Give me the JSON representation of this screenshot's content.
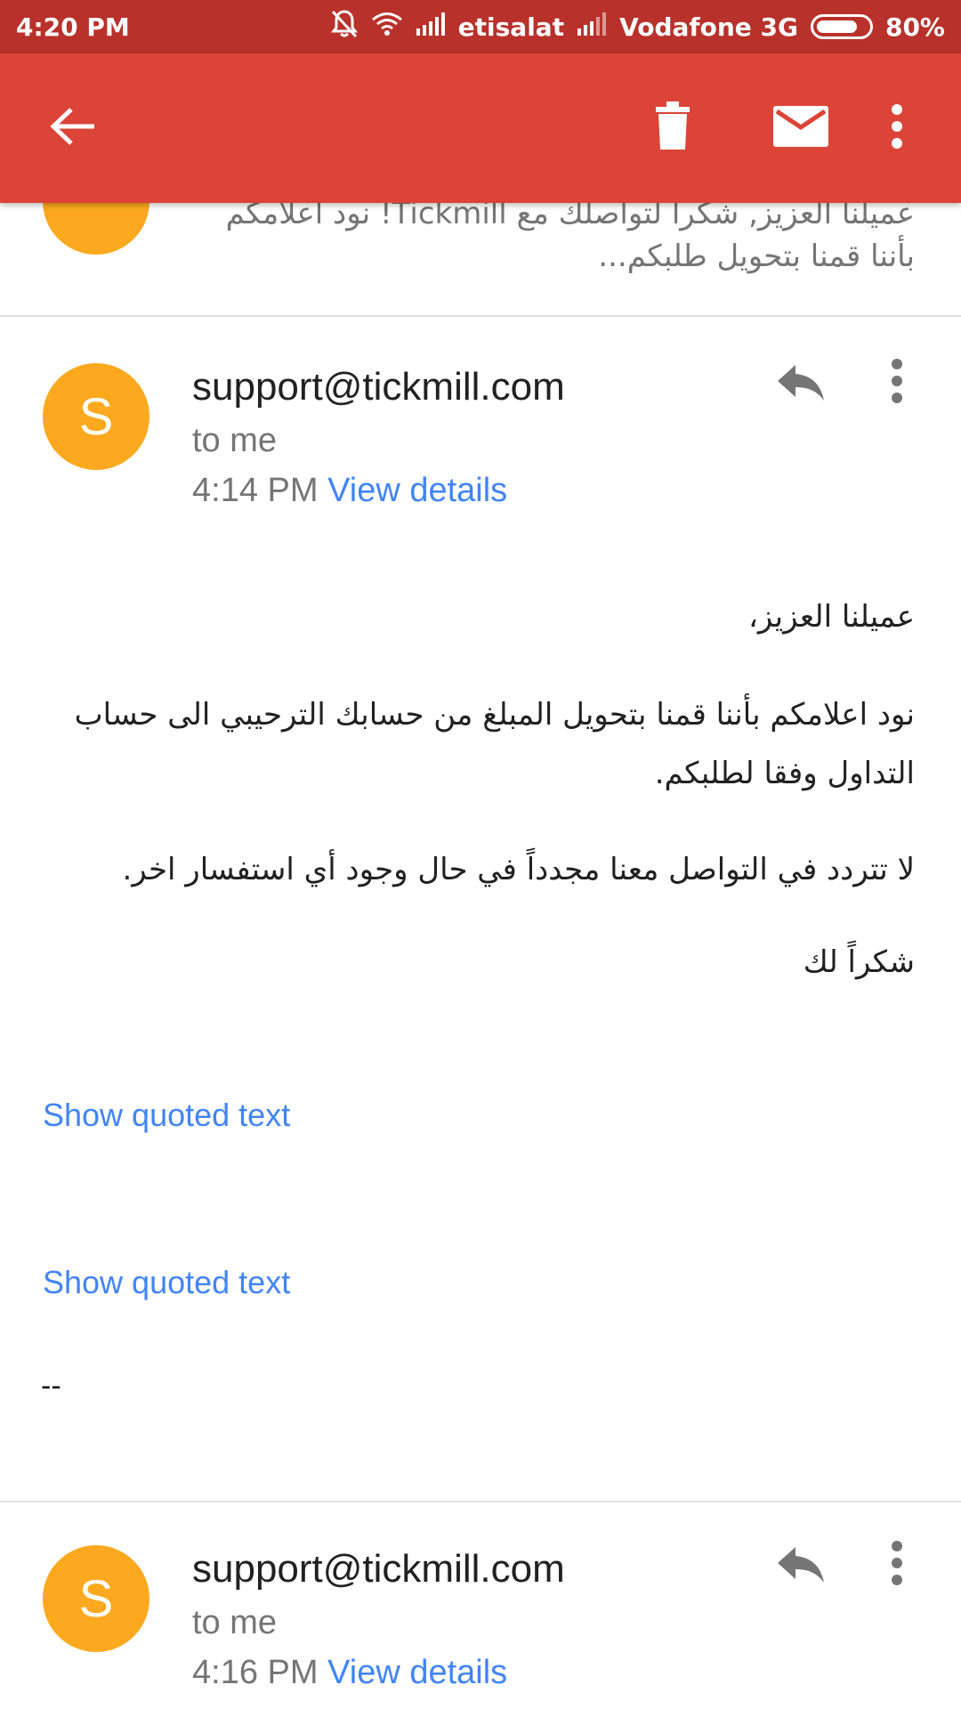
{
  "status_bar": {
    "time": "4:20 PM",
    "carrier1": "etisalat",
    "carrier2": "Vodafone 3G",
    "battery": "80%",
    "battery_level": 0.8,
    "icons": [
      "mute-bell-icon",
      "wifi-icon",
      "signal-icon",
      "signal-icon",
      "battery-icon"
    ]
  },
  "app_bar": {
    "color": "#db4437",
    "icons": [
      "back-arrow-icon",
      "delete-icon",
      "mark-unread-icon",
      "more-vert-icon"
    ]
  },
  "previous_snippet": {
    "text": "عميلنا العزيز, شكراً لتواصلك مع Tickmill! نود اعلامكم بأننا قمنا بتحويل طلبكم..."
  },
  "messages": [
    {
      "avatar_letter": "S",
      "avatar_color": "#fca91f",
      "sender": "support@tickmill.com",
      "recipient": "to me",
      "time": "4:14 PM",
      "details_link": "View details",
      "body": {
        "greeting": "عميلنا العزيز،",
        "para1": "نود اعلامكم بأننا قمنا بتحويل المبلغ من حسابك الترحيبي الى حساب التداول وفقا لطلبكم.",
        "para2": "لا تتردد في التواصل معنا مجدداً في حال وجود أي استفسار اخر.",
        "closing": "شكراً لك"
      },
      "quoted_link_1": "Show quoted text",
      "quoted_link_2": "Show quoted text",
      "signature": "--"
    },
    {
      "avatar_letter": "S",
      "avatar_color": "#fca91f",
      "sender": "support@tickmill.com",
      "recipient": "to me",
      "time": "4:16 PM",
      "details_link": "View details"
    }
  ]
}
